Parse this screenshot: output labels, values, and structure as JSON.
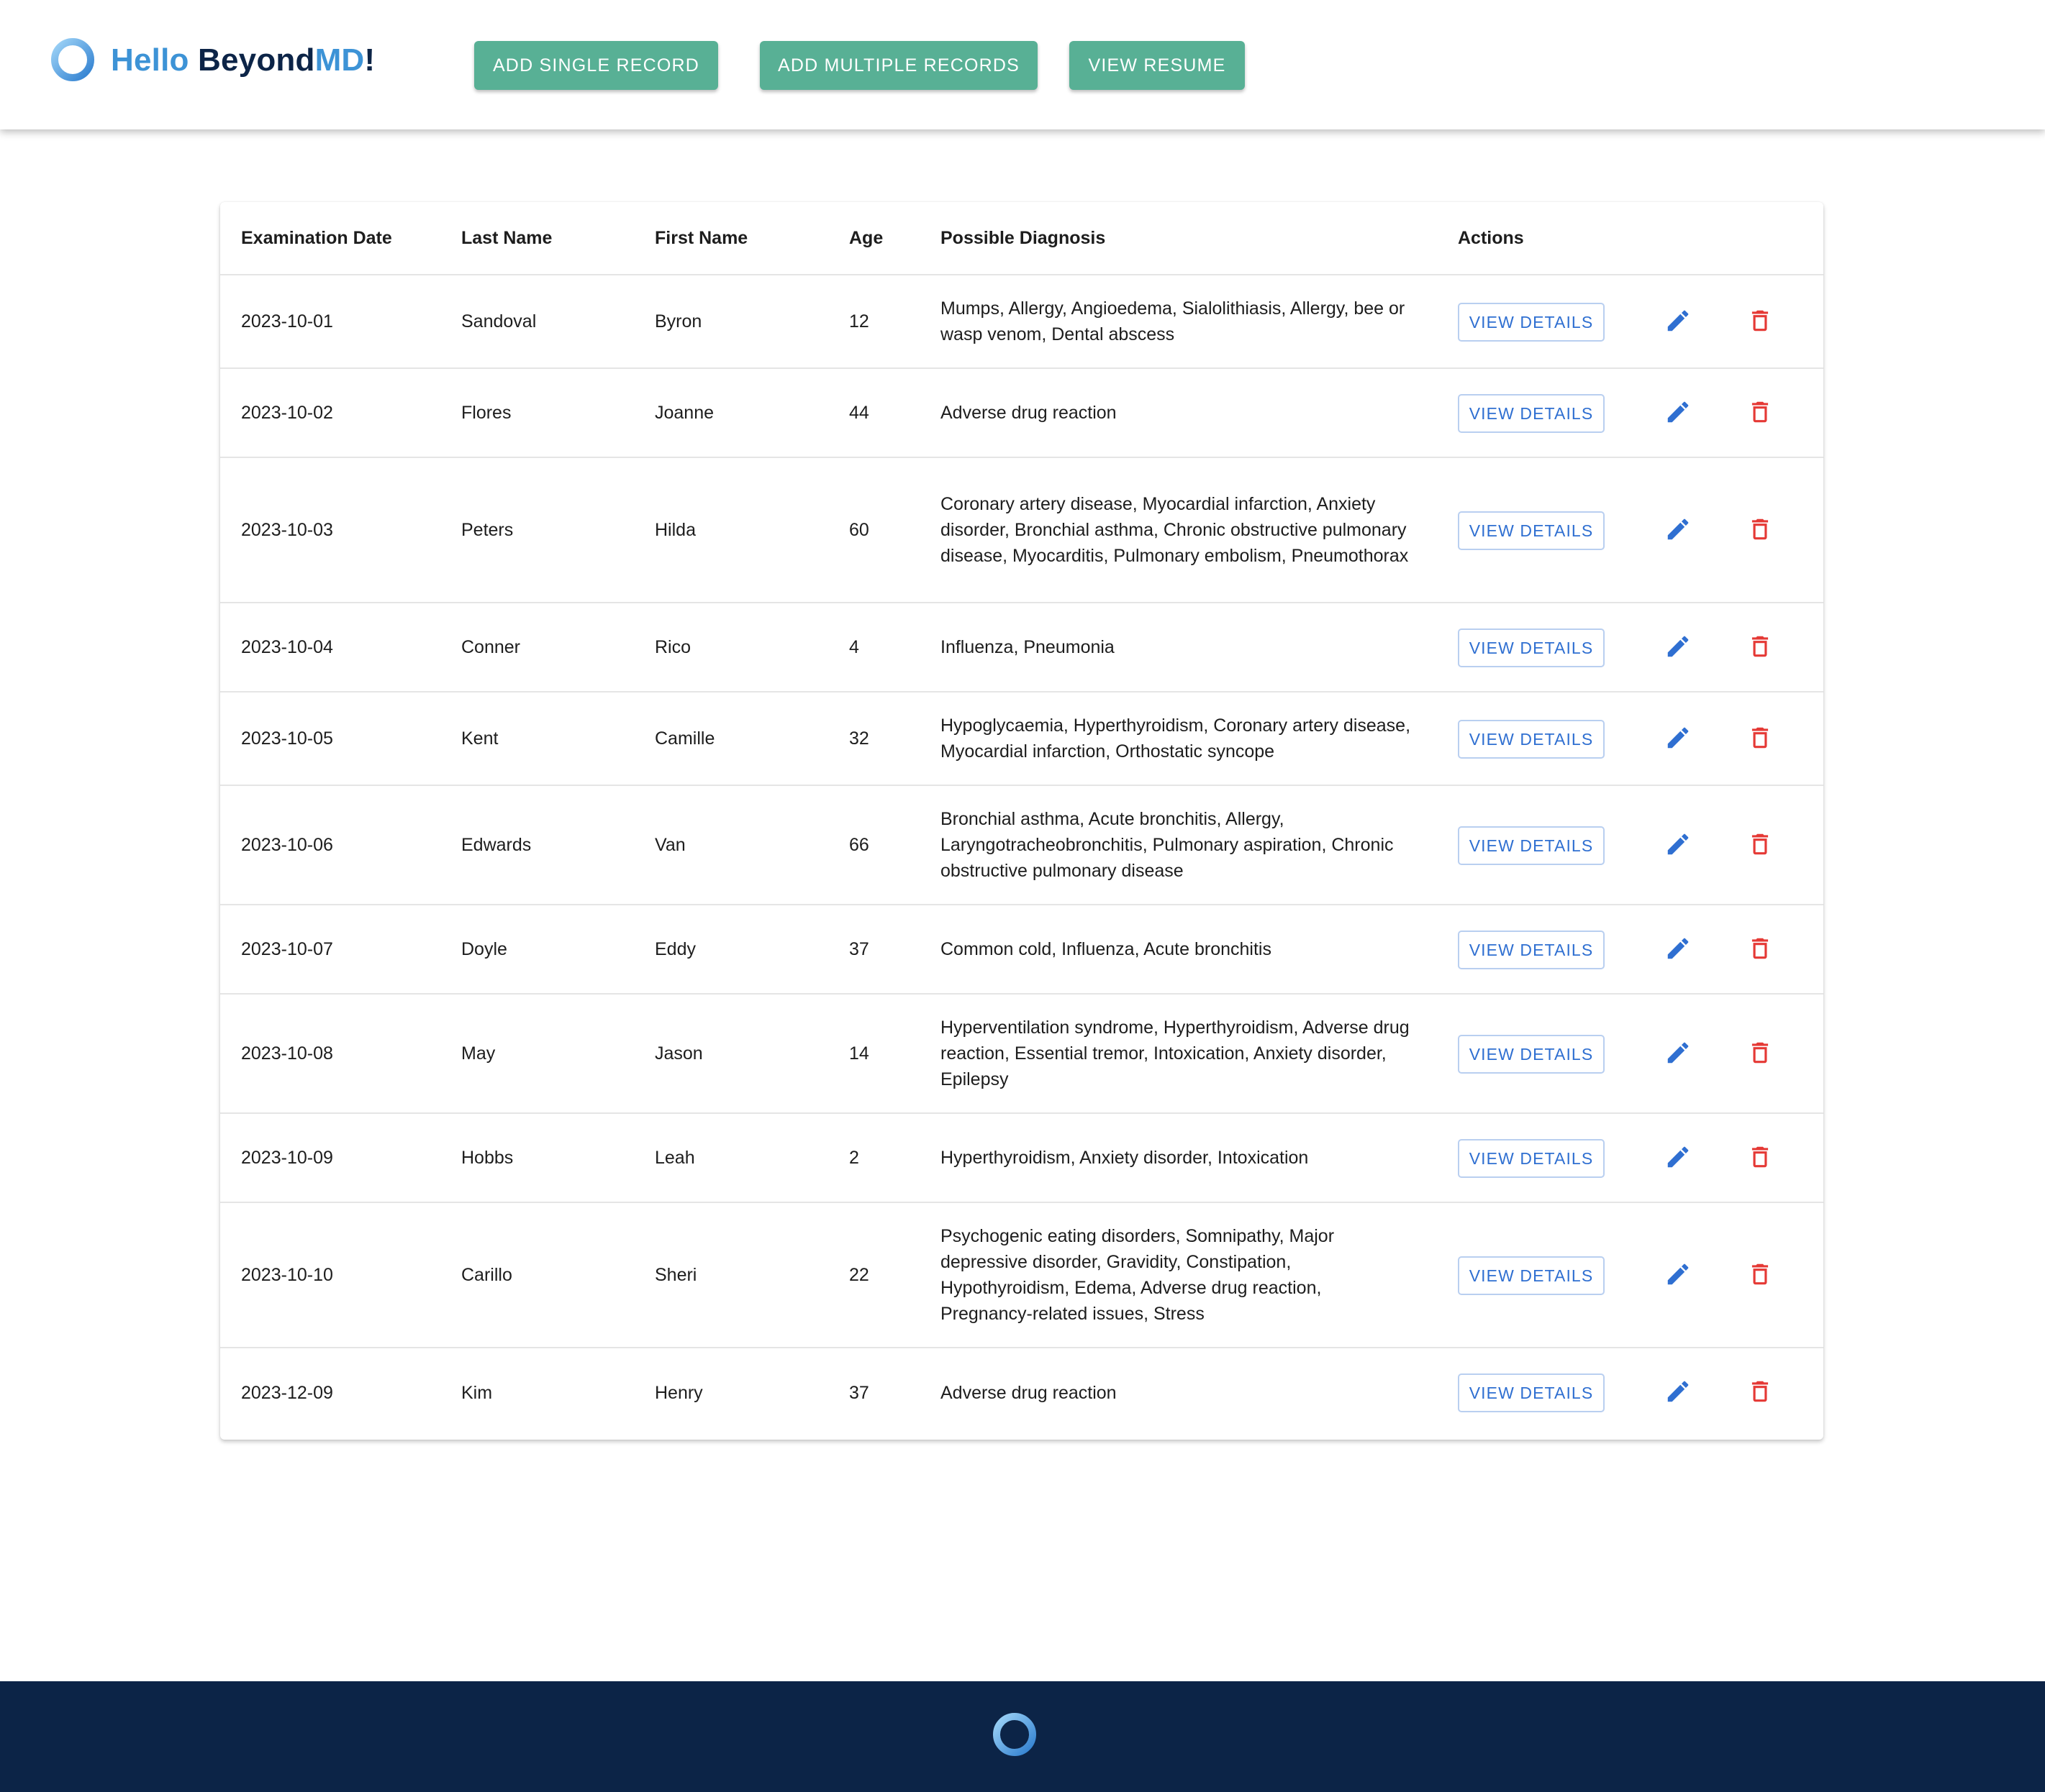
{
  "header": {
    "brand_hello": "Hello",
    "brand_beyond": "Beyond",
    "brand_md": "MD",
    "brand_bang": "!",
    "buttons": {
      "add_single": "ADD SINGLE RECORD",
      "add_multiple": "ADD MULTIPLE RECORDS",
      "view_resume": "VIEW RESUME"
    }
  },
  "table": {
    "columns": {
      "date": "Examination Date",
      "last": "Last Name",
      "first": "First Name",
      "age": "Age",
      "diagnosis": "Possible Diagnosis",
      "actions": "Actions"
    },
    "view_label": "VIEW DETAILS",
    "rows": [
      {
        "date": "2023-10-01",
        "last": "Sandoval",
        "first": "Byron",
        "age": "12",
        "diagnosis": "Mumps, Allergy, Angioedema, Sialolithiasis, Allergy, bee or wasp venom, Dental abscess"
      },
      {
        "date": "2023-10-02",
        "last": "Flores",
        "first": "Joanne",
        "age": "44",
        "diagnosis": "Adverse drug reaction"
      },
      {
        "date": "2023-10-03",
        "last": "Peters",
        "first": "Hilda",
        "age": "60",
        "diagnosis": "Coronary artery disease, Myocardial infarction, Anxiety disorder, Bronchial asthma, Chronic obstructive pulmonary disease, Myocarditis, Pulmonary embolism, Pneumothorax"
      },
      {
        "date": "2023-10-04",
        "last": "Conner",
        "first": "Rico",
        "age": "4",
        "diagnosis": "Influenza, Pneumonia"
      },
      {
        "date": "2023-10-05",
        "last": "Kent",
        "first": "Camille",
        "age": "32",
        "diagnosis": "Hypoglycaemia, Hyperthyroidism, Coronary artery disease, Myocardial infarction, Orthostatic syncope"
      },
      {
        "date": "2023-10-06",
        "last": "Edwards",
        "first": "Van",
        "age": "66",
        "diagnosis": "Bronchial asthma, Acute bronchitis, Allergy, Laryngotracheobronchitis, Pulmonary aspiration, Chronic obstructive pulmonary disease"
      },
      {
        "date": "2023-10-07",
        "last": "Doyle",
        "first": "Eddy",
        "age": "37",
        "diagnosis": "Common cold, Influenza, Acute bronchitis"
      },
      {
        "date": "2023-10-08",
        "last": "May",
        "first": "Jason",
        "age": "14",
        "diagnosis": "Hyperventilation syndrome, Hyperthyroidism, Adverse drug reaction, Essential tremor, Intoxication, Anxiety disorder, Epilepsy"
      },
      {
        "date": "2023-10-09",
        "last": "Hobbs",
        "first": "Leah",
        "age": "2",
        "diagnosis": "Hyperthyroidism, Anxiety disorder, Intoxication"
      },
      {
        "date": "2023-10-10",
        "last": "Carillo",
        "first": "Sheri",
        "age": "22",
        "diagnosis": "Psychogenic eating disorders, Somnipathy, Major depressive disorder, Gravidity, Constipation, Hypothyroidism, Edema, Adverse drug reaction, Pregnancy-related issues, Stress"
      },
      {
        "date": "2023-12-09",
        "last": "Kim",
        "first": "Henry",
        "age": "37",
        "diagnosis": "Adverse drug reaction"
      }
    ]
  },
  "icons": {
    "logo": "ring-logo-icon",
    "edit": "pencil-icon",
    "delete": "trash-icon"
  },
  "colors": {
    "accent_button": "#58b095",
    "brand_blue": "#3d93d6",
    "navy": "#0c2447",
    "link_blue": "#2f6fd1",
    "delete_red": "#e53935"
  }
}
